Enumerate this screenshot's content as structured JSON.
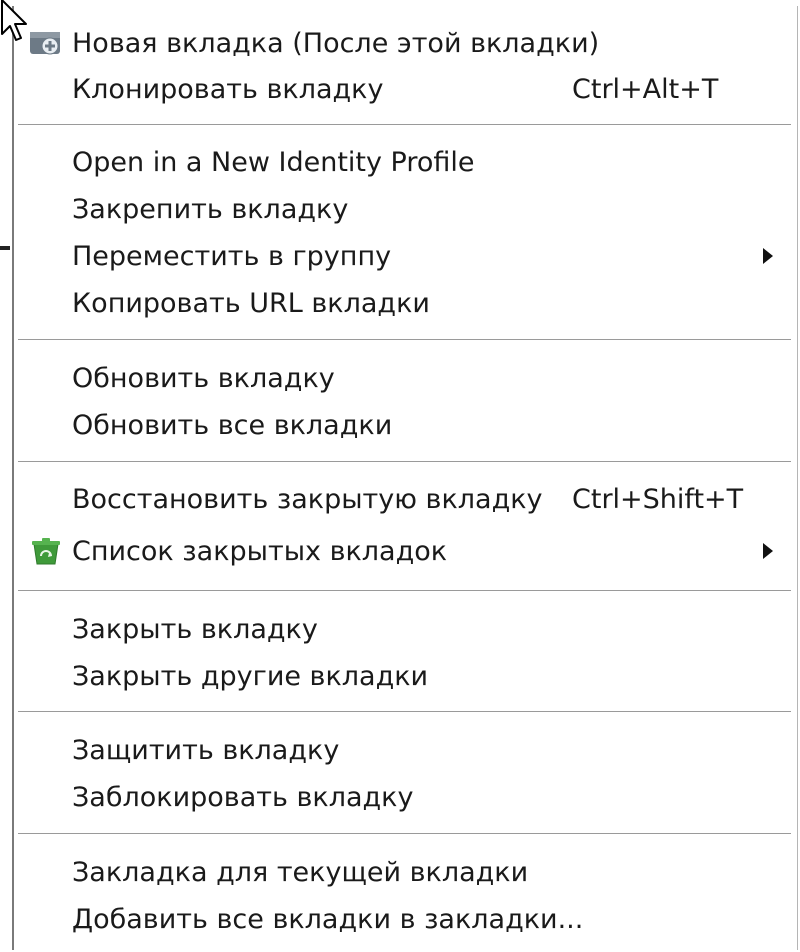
{
  "menu": {
    "items": [
      {
        "id": "new-tab",
        "label": "Новая вкладка  (После этой вкладки)",
        "icon": "new-tab-icon"
      },
      {
        "id": "clone-tab",
        "label": "Клонировать вкладку",
        "shortcut": "Ctrl+Alt+T"
      },
      {
        "id": "open-new-identity",
        "label": "Open in a New Identity Profile"
      },
      {
        "id": "pin-tab",
        "label": "Закрепить вкладку"
      },
      {
        "id": "move-to-group",
        "label": "Переместить в группу",
        "submenu": true
      },
      {
        "id": "copy-url",
        "label": "Копировать URL вкладки"
      },
      {
        "id": "reload-tab",
        "label": "Обновить вкладку"
      },
      {
        "id": "reload-all",
        "label": "Обновить все вкладки"
      },
      {
        "id": "restore-closed",
        "label": "Восстановить закрытую вкладку",
        "shortcut": "Ctrl+Shift+T"
      },
      {
        "id": "closed-tabs-list",
        "label": "Список закрытых вкладок",
        "icon": "recycle-bin-icon",
        "submenu": true
      },
      {
        "id": "close-tab",
        "label": "Закрыть вкладку"
      },
      {
        "id": "close-other",
        "label": "Закрыть другие вкладки"
      },
      {
        "id": "protect-tab",
        "label": "Защитить вкладку"
      },
      {
        "id": "lock-tab",
        "label": "Заблокировать вкладку"
      },
      {
        "id": "bookmark-tab",
        "label": "Закладка для текущей вкладки"
      },
      {
        "id": "bookmark-all",
        "label": "Добавить все вкладки в закладки..."
      }
    ]
  },
  "colors": {
    "menu_bg": "#ffffff",
    "separator": "#9a9a9a",
    "text": "#1a1a1a",
    "icon_green": "#3f9a3a",
    "icon_gray": "#6d7a86"
  }
}
